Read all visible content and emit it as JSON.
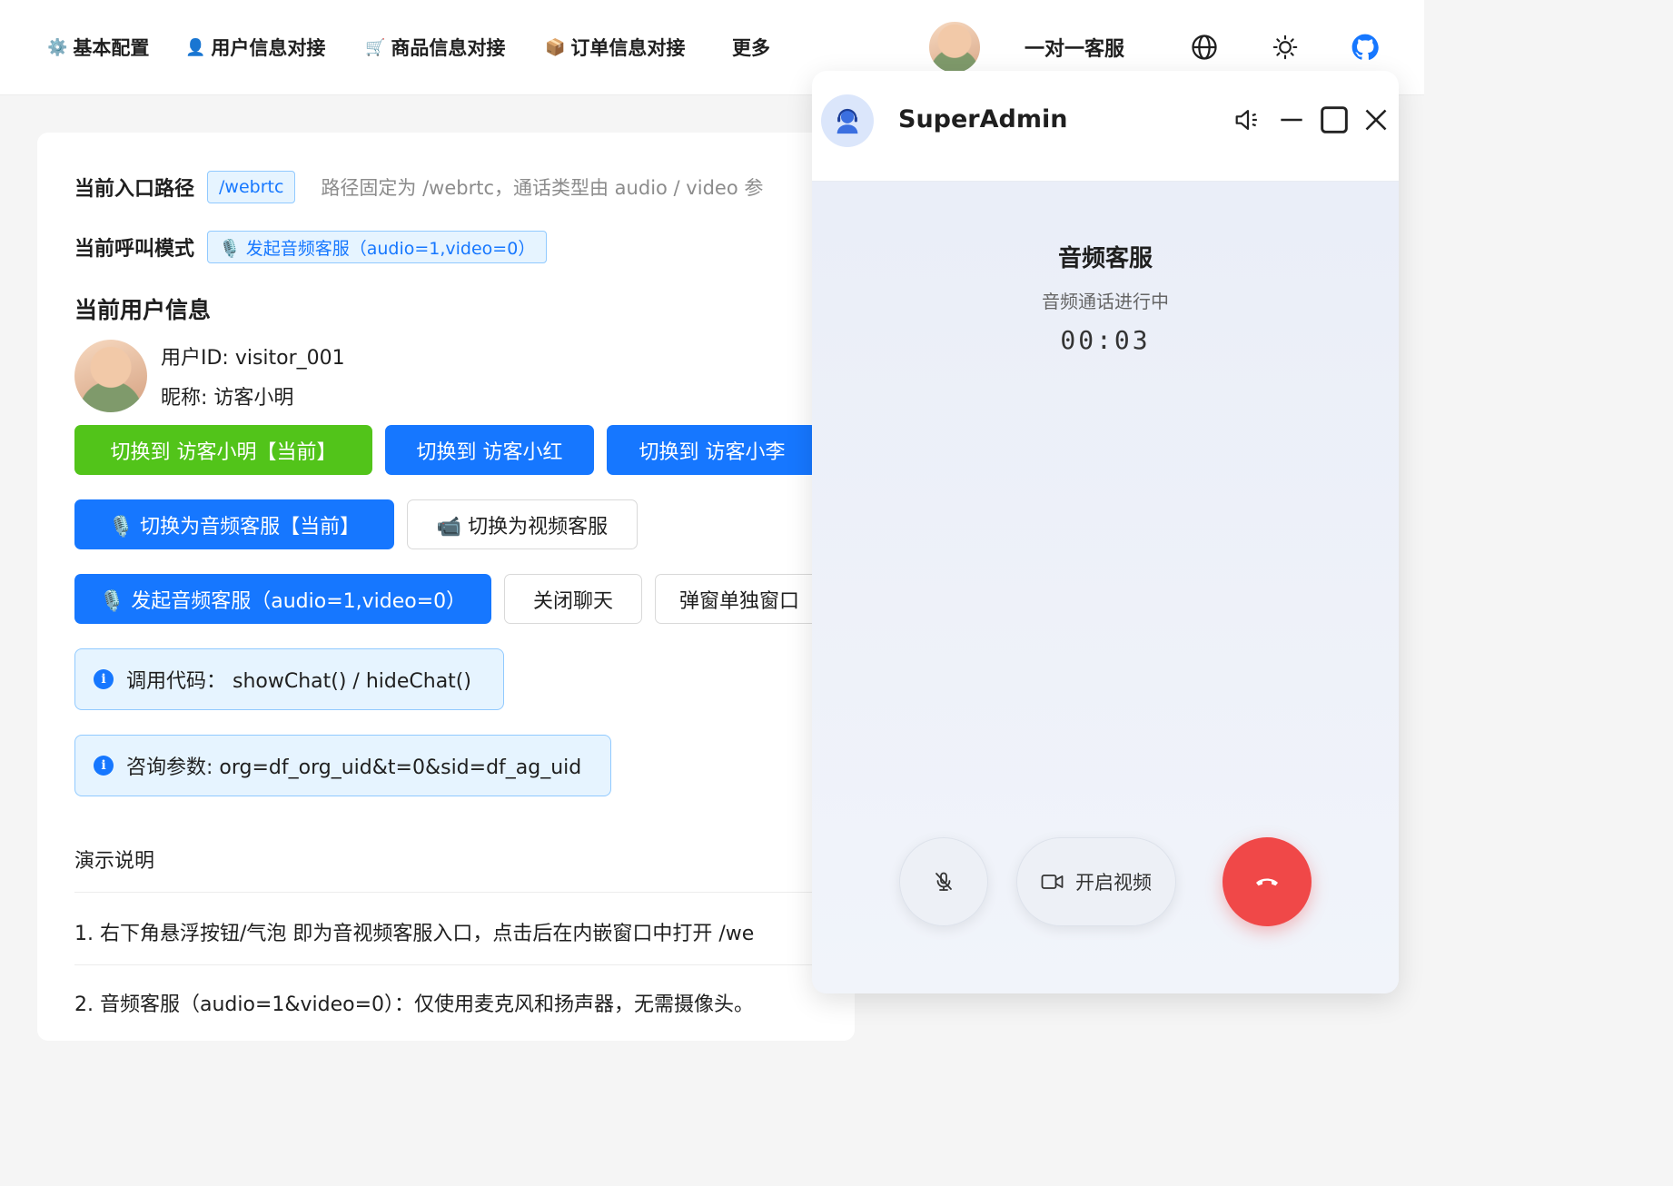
{
  "nav": {
    "items": [
      {
        "emoji": "⚙️",
        "label": "基本配置"
      },
      {
        "emoji": "👤",
        "label": "用户信息对接"
      },
      {
        "emoji": "🛒",
        "label": "商品信息对接"
      },
      {
        "emoji": "📦",
        "label": "订单信息对接"
      },
      {
        "emoji": "",
        "label": "更多"
      }
    ],
    "service_label": "一对一客服",
    "icons": [
      "globe-icon",
      "sun-icon",
      "github-icon"
    ]
  },
  "main": {
    "entry_path_label": "当前入口路径",
    "entry_path_tag": "/webrtc",
    "entry_path_hint": "路径固定为 /webrtc，通话类型由 audio / video 参",
    "call_mode_label": "当前呼叫模式",
    "call_mode_tag": "🎙️ 发起音频客服（audio=1,video=0）",
    "user_section_title": "当前用户信息",
    "user_id_line": "用户ID: visitor_001",
    "nickname_line": "昵称: 访客小明",
    "switch_user_buttons": [
      "切换到 访客小明【当前】",
      "切换到 访客小红",
      "切换到 访客小李"
    ],
    "switch_mode_buttons": [
      "🎙️ 切换为音频客服【当前】",
      "📹 切换为视频客服"
    ],
    "action_buttons": [
      "🎙️ 发起音频客服（audio=1,video=0）",
      "关闭聊天",
      "弹窗单独窗口"
    ],
    "alert_code": "调用代码：  showChat() / hideChat()",
    "alert_params": "咨询参数: org=df_org_uid&t=0&sid=df_ag_uid",
    "demo_title": "演示说明",
    "demo_lines": [
      "1. 右下角悬浮按钮/气泡 即为音视频客服入口，点击后在内嵌窗口中打开 /we",
      "2. 音频客服（audio=1&video=0）：仅使用麦克风和扬声器，无需摄像头。"
    ]
  },
  "call": {
    "agent_name": "SuperAdmin",
    "title": "音频客服",
    "status": "音频通话进行中",
    "timer": "00:03",
    "video_button_label": "开启视频",
    "colors": {
      "hangup": "#f04848",
      "accent": "#1677ff"
    }
  }
}
